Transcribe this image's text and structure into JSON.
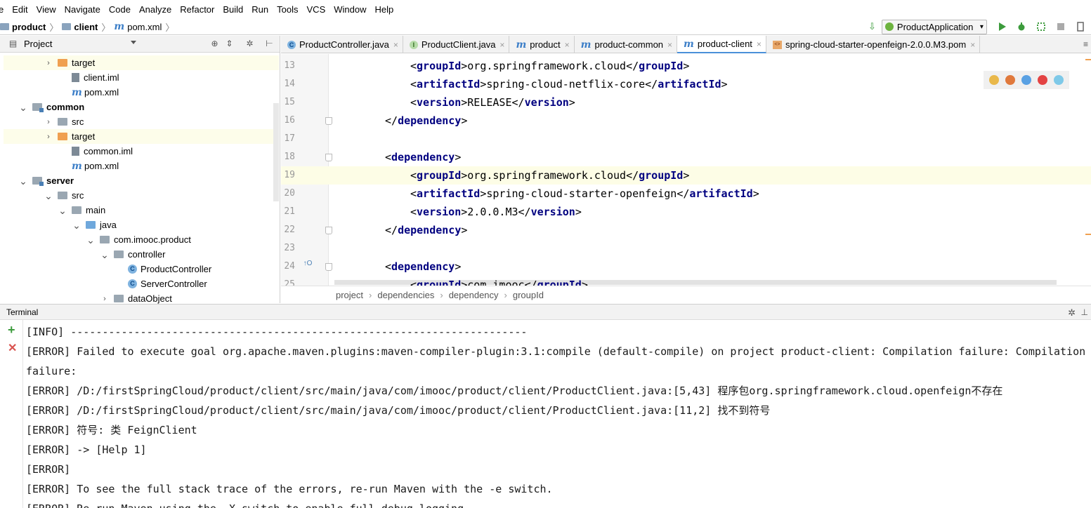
{
  "menu": [
    "e",
    "Edit",
    "View",
    "Navigate",
    "Code",
    "Analyze",
    "Refactor",
    "Build",
    "Run",
    "Tools",
    "VCS",
    "Window",
    "Help"
  ],
  "navbar": {
    "crumbs": [
      "product",
      "client",
      "pom.xml"
    ],
    "run_config": "ProductApplication"
  },
  "project": {
    "title": "Project",
    "tree": [
      {
        "label": "target",
        "indent": 1,
        "arrow": "right",
        "icon": "folder-orange",
        "hl": true
      },
      {
        "label": "client.iml",
        "indent": 2,
        "arrow": "none",
        "icon": "iml"
      },
      {
        "label": "pom.xml",
        "indent": 2,
        "arrow": "none",
        "icon": "maven"
      },
      {
        "label": "common",
        "indent": 0,
        "arrow": "down",
        "icon": "module",
        "bold": true
      },
      {
        "label": "src",
        "indent": 1,
        "arrow": "right",
        "icon": "folder-grey"
      },
      {
        "label": "target",
        "indent": 1,
        "arrow": "right",
        "icon": "folder-orange",
        "hl": true
      },
      {
        "label": "common.iml",
        "indent": 2,
        "arrow": "none",
        "icon": "iml"
      },
      {
        "label": "pom.xml",
        "indent": 2,
        "arrow": "none",
        "icon": "maven"
      },
      {
        "label": "server",
        "indent": 0,
        "arrow": "down",
        "icon": "module",
        "bold": true
      },
      {
        "label": "src",
        "indent": 1,
        "arrow": "down",
        "icon": "folder-grey"
      },
      {
        "label": "main",
        "indent": 2,
        "arrow": "down",
        "icon": "folder-grey"
      },
      {
        "label": "java",
        "indent": 3,
        "arrow": "down",
        "icon": "folder-blue"
      },
      {
        "label": "com.imooc.product",
        "indent": 4,
        "arrow": "down",
        "icon": "package"
      },
      {
        "label": "controller",
        "indent": 5,
        "arrow": "down",
        "icon": "package"
      },
      {
        "label": "ProductController",
        "indent": 6,
        "arrow": "none",
        "icon": "class"
      },
      {
        "label": "ServerController",
        "indent": 6,
        "arrow": "none",
        "icon": "class"
      },
      {
        "label": "dataObject",
        "indent": 5,
        "arrow": "right",
        "icon": "package"
      }
    ]
  },
  "tabs": [
    {
      "label": "ProductController.java",
      "icon": "class"
    },
    {
      "label": "ProductClient.java",
      "icon": "interface"
    },
    {
      "label": "product",
      "icon": "maven"
    },
    {
      "label": "product-common",
      "icon": "maven"
    },
    {
      "label": "product-client",
      "icon": "maven",
      "active": true
    },
    {
      "label": "spring-cloud-starter-openfeign-2.0.0.M3.pom",
      "icon": "xml"
    }
  ],
  "editor": {
    "lines": [
      {
        "n": "13",
        "indent": 2,
        "tag": "groupId",
        "text": "org.springframework.cloud"
      },
      {
        "n": "14",
        "indent": 2,
        "tag": "artifactId",
        "text": "spring-cloud-netflix-core"
      },
      {
        "n": "15",
        "indent": 2,
        "tag": "version",
        "text": "RELEASE"
      },
      {
        "n": "16",
        "indent": 1,
        "close": "dependency",
        "fold": true
      },
      {
        "n": "17"
      },
      {
        "n": "18",
        "indent": 1,
        "open": "dependency",
        "fold": true
      },
      {
        "n": "19",
        "indent": 2,
        "tag": "groupId",
        "text": "org.springframework.cloud",
        "current": true
      },
      {
        "n": "20",
        "indent": 2,
        "tag": "artifactId",
        "text": "spring-cloud-starter-openfeign"
      },
      {
        "n": "21",
        "indent": 2,
        "tag": "version",
        "text": "2.0.0.M3"
      },
      {
        "n": "22",
        "indent": 1,
        "close": "dependency",
        "fold": true
      },
      {
        "n": "23"
      },
      {
        "n": "24",
        "indent": 1,
        "open": "dependency",
        "fold": true
      },
      {
        "n": "25",
        "indent": 2,
        "tag": "groupId",
        "text": "com.imooc"
      }
    ],
    "breadcrumb": [
      "project",
      "dependencies",
      "dependency",
      "groupId"
    ]
  },
  "terminal": {
    "title": "Terminal",
    "lines": [
      "[INFO] ------------------------------------------------------------------------",
      "[ERROR] Failed to execute goal org.apache.maven.plugins:maven-compiler-plugin:3.1:compile (default-compile) on project product-client: Compilation failure: Compilation",
      "failure:",
      "[ERROR] /D:/firstSpringCloud/product/client/src/main/java/com/imooc/product/client/ProductClient.java:[5,43] 程序包org.springframework.cloud.openfeign不存在",
      "[ERROR] /D:/firstSpringCloud/product/client/src/main/java/com/imooc/product/client/ProductClient.java:[11,2] 找不到符号",
      "[ERROR] 符号: 类 FeignClient",
      "[ERROR] -> [Help 1]",
      "[ERROR]",
      "[ERROR] To see the full stack trace of the errors, re-run Maven with the -e switch.",
      "[ERROR] Re-run Maven using the -X switch to enable full debug logging."
    ]
  }
}
